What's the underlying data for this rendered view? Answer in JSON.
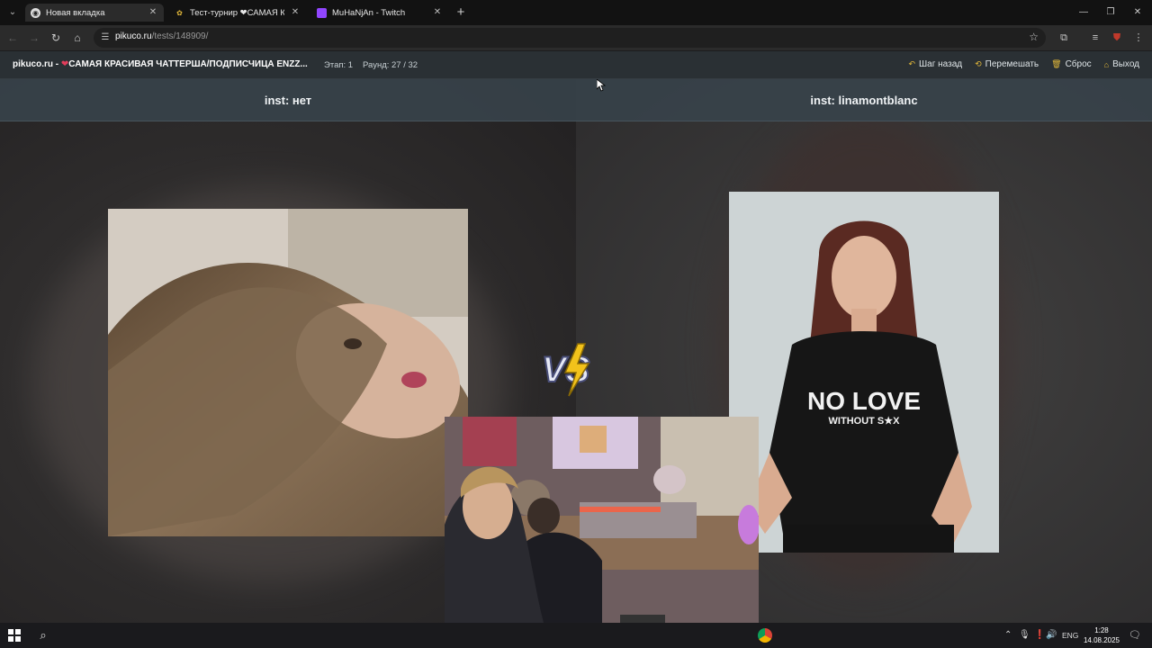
{
  "browser": {
    "tabs": [
      {
        "title": "Новая вкладка",
        "favicon": "chrome-icon",
        "active": true
      },
      {
        "title": "Тест-турнир ❤САМАЯ КРАСИ",
        "favicon": "pikuco-icon",
        "active": false
      },
      {
        "title": "MuHaNjAn - Twitch",
        "favicon": "twitch-icon",
        "active": false
      }
    ],
    "url_host": "pikuco.ru",
    "url_path": "/tests/148909/"
  },
  "site": {
    "brand": "pikuco.ru -",
    "heart": "❤",
    "test_title": "САМАЯ КРАСИВАЯ ЧАТТЕРША/ПОДПИСЧИЦА ENZZ...",
    "stage": "Этап: 1",
    "round": "Раунд: 27 / 32",
    "actions": {
      "back": "Шаг назад",
      "shuffle": "Перемешать",
      "reset": "Сброс",
      "exit": "Выход"
    }
  },
  "contest": {
    "left_label": "inst: нет",
    "right_label": "inst: linamontblanc",
    "vs_text": "VS",
    "shirt_text_1": "NO LOVE",
    "shirt_text_2": "WITHOUT S★X"
  },
  "taskbar": {
    "lang": "ENG",
    "time": "1:28",
    "date": "14.08.2025"
  },
  "colors": {
    "accent_heart": "#e23d5b",
    "action_icon": "#e2b83a",
    "label_bar": "#37424a",
    "twitch": "#9146ff"
  }
}
